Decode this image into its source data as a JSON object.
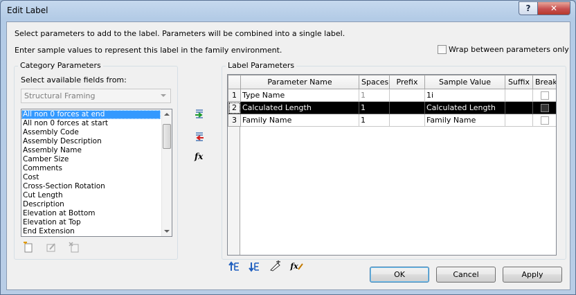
{
  "window": {
    "title": "Edit Label",
    "help_label": "?",
    "close_label": "✕"
  },
  "intro": {
    "line1": "Select parameters to add to the label.  Parameters will be combined into a single label.",
    "line2": "Enter sample values to represent this label in the family environment."
  },
  "wrap_option": {
    "label": "Wrap between parameters only",
    "checked": false
  },
  "category": {
    "group_title": "Category Parameters",
    "select_label": "Select available fields from:",
    "combo_value": "Structural Framing",
    "fields": [
      "All non 0 forces at end",
      "All non 0 forces at start",
      "Assembly Code",
      "Assembly Description",
      "Assembly Name",
      "Camber Size",
      "Comments",
      "Cost",
      "Cross-Section Rotation",
      "Cut Length",
      "Description",
      "Elevation at Bottom",
      "Elevation at Top",
      "End Extension"
    ],
    "selected_index": 0
  },
  "icons": {
    "add": "add-parameter-icon",
    "remove": "remove-parameter-icon",
    "formula": "fx-icon",
    "new_param": "new-parameter-icon",
    "edit_param": "edit-parameter-icon",
    "delete_param": "delete-parameter-icon",
    "move_up": "move-up-icon",
    "move_down": "move-down-icon",
    "sample_edit": "edit-sample-icon",
    "formula_edit": "fx-edit-icon"
  },
  "formula_glyph": "fx",
  "label_params": {
    "group_title": "Label Parameters",
    "columns": [
      "Parameter Name",
      "Spaces",
      "Prefix",
      "Sample Value",
      "Suffix",
      "Break"
    ],
    "rows": [
      {
        "num": "1",
        "name": "Type Name",
        "spaces": "1",
        "prefix": "",
        "sample": "1i",
        "suffix": "",
        "brk": false
      },
      {
        "num": "2",
        "name": "Calculated Length",
        "spaces": "1",
        "prefix": "",
        "sample": "Calculated Length",
        "suffix": "",
        "brk": false
      },
      {
        "num": "3",
        "name": "Family Name",
        "spaces": "1",
        "prefix": "",
        "sample": "Family Name",
        "suffix": "",
        "brk": false
      }
    ],
    "selected_row": 1
  },
  "buttons": {
    "ok": "OK",
    "cancel": "Cancel",
    "apply": "Apply"
  },
  "colors": {
    "selection": "#3399ff",
    "row_selected": "#000000"
  }
}
